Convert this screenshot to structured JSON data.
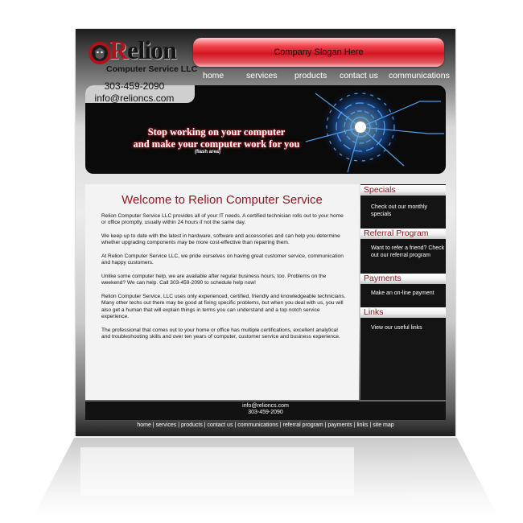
{
  "brand": {
    "name": "Relion",
    "tagline": "Computer Service LLC",
    "phone": "303-459-2090",
    "email": "info@relioncs.com",
    "accent": "#d31523"
  },
  "header": {
    "slogan": "Company Slogan Here",
    "nav": [
      "home",
      "services",
      "products",
      "contact us",
      "communications"
    ]
  },
  "banner": {
    "line1": "Stop working on your computer",
    "line2": "and make your computer work for you",
    "note": "(flash area)"
  },
  "main": {
    "title": "Welcome to Relion Computer Service",
    "paragraphs": [
      "Relion Computer Service LLC provides all of your IT needs. A certified technician rolls out to your home or office promptly, usually within 24 hours if not the same day.",
      "We keep up to date with the latest in hardware, software and accessories and can help you determine whether upgrading components may be more cost-effective than repairing them.",
      "At Relion Computer Service LLC, we pride ourselves on having great customer service, communication and happy customers.",
      "Unlike some computer help, we are available after regular business hours, too. Problems on the weekend? We can help. Call 303-459-2090 to schedule help now!",
      "Relion Computer Service, LLC uses only experienced, certified, friendly and knowledgeable technicians. Many other techs out there may be good at fixing specific problems, but when you deal with us, you will also get a human that will explain things in terms you can understand and a top notch service experience.",
      "The professional that comes out to your home or office has multiple certifications, excellent analytical and troubleshooting skills and over ten years of computer, customer service and business experience."
    ]
  },
  "sidebar": [
    {
      "heading": "Specials",
      "text": "Check out our monthly specials"
    },
    {
      "heading": "Referral Program",
      "text": "Want to refer a friend? Check out our referral program"
    },
    {
      "heading": "Payments",
      "text": "Make an on-line payment"
    },
    {
      "heading": "Links",
      "text": "View our useful links"
    }
  ],
  "footer": {
    "email": "info@relioncs.com",
    "phone": "303-459-2090",
    "links": [
      "home",
      "services",
      "products",
      "contact us",
      "communications",
      "referral program",
      "payments",
      "links",
      "site map"
    ],
    "separator": " | "
  }
}
